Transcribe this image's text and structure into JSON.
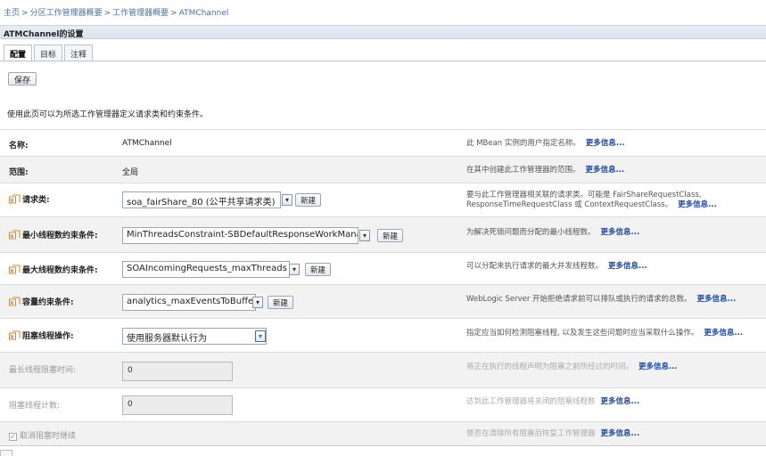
{
  "breadcrumb": {
    "items": [
      "主页",
      "分区工作管理器概要",
      "工作管理器概要",
      "ATMChannel"
    ],
    "sep": ">"
  },
  "title": "ATMChannel的设置",
  "tabs": [
    {
      "label": "配置",
      "active": true
    },
    {
      "label": "目标",
      "active": false
    },
    {
      "label": "注释",
      "active": false
    }
  ],
  "save_label": "保存",
  "description": "使用此页可以为所选工作管理器定义请求类和约束条件。",
  "more_info": "更多信息...",
  "new_label": "新建",
  "rows": {
    "name": {
      "label": "名称:",
      "value": "ATMChannel",
      "help": "此 MBean 实例的用户指定名称。"
    },
    "scope": {
      "label": "范围:",
      "value": "全局",
      "help": "在其中创建此工作管理器的范围。"
    },
    "request_class": {
      "label": "请求类:",
      "value": "soa_fairShare_80 (公平共享请求类)",
      "help": "要与此工作管理器相关联的请求类。可能是 FairShareRequestClass, ResponseTimeRequestClass 或 ContextRequestClass。"
    },
    "min_threads": {
      "label": "最小线程数约束条件:",
      "value": "MinThreadsConstraint-SBDefaultResponseWorkManager",
      "help": "为解决死锁问题而分配的最小线程数。"
    },
    "max_threads": {
      "label": "最大线程数约束条件:",
      "value": "SOAIncomingRequests_maxThreads",
      "help": "可以分配来执行请求的最大并发线程数。"
    },
    "capacity": {
      "label": "容量约束条件:",
      "value": "analytics_maxEventsToBuffer",
      "help": "WebLogic Server 开始拒绝请求前可以排队或执行的请求的总数。"
    },
    "stuck_action": {
      "label": "阻塞线程操作:",
      "value": "使用服务器默认行为",
      "help": "指定应当如何检测阻塞线程, 以及发生这些问题时应当采取什么操作。"
    },
    "max_stuck_time": {
      "label": "最长线程阻塞时间:",
      "value": "0",
      "help": "将正在执行的线程声明为阻塞之前所经过的时间。"
    },
    "stuck_count": {
      "label": "阻塞线程计数:",
      "value": "0",
      "help": "达到此工作管理器将关闭的阻塞线程数"
    },
    "ignore_stuck": {
      "label": "取消阻塞时继续",
      "checked": true,
      "help": "是否在清除所有阻塞后恢复工作管理器"
    }
  },
  "icon_color": "#d98a1a"
}
